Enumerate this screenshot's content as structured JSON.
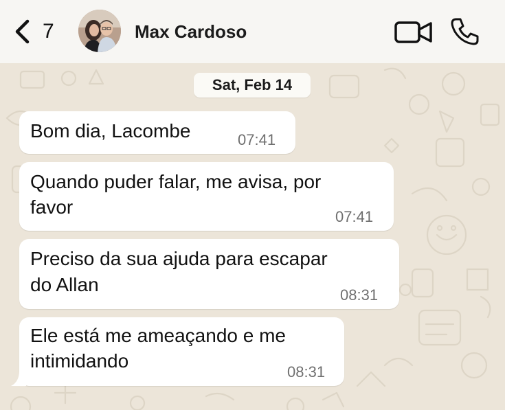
{
  "header": {
    "back_count": "7",
    "contact_name": "Max Cardoso",
    "icons": {
      "back": "chevron-left-icon",
      "video": "video-call-icon",
      "phone": "phone-call-icon"
    }
  },
  "chat": {
    "date_label": "Sat, Feb 14",
    "bubble_color": "#ffffff",
    "wallpaper_color": "#ece5d9",
    "messages": [
      {
        "lines": [
          "Bom dia, Lacombe"
        ],
        "time": "07:41"
      },
      {
        "lines": [
          "Quando puder falar, me avisa, por",
          "favor"
        ],
        "time": "07:41"
      },
      {
        "lines": [
          "Preciso da sua ajuda para escapar",
          "do Allan"
        ],
        "time": "08:31"
      },
      {
        "lines": [
          "Ele está me ameaçando e me",
          "intimidando"
        ],
        "time": "08:31"
      }
    ]
  }
}
